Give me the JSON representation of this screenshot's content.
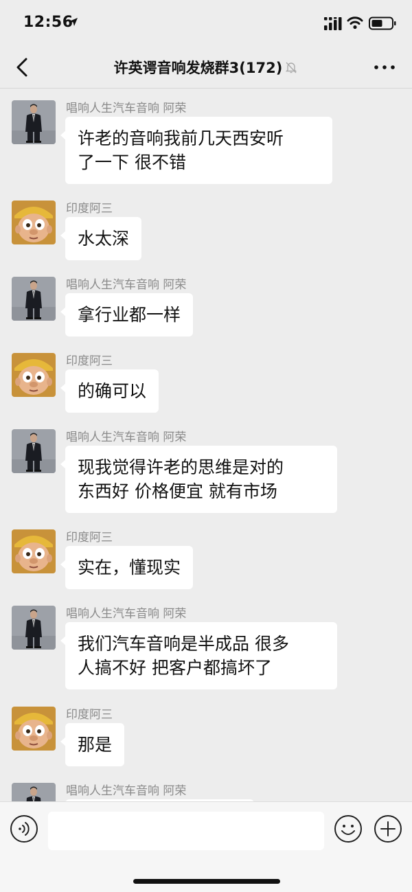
{
  "status_bar": {
    "time": "12:56"
  },
  "header": {
    "title": "许英谔音响发烧群3(172)"
  },
  "messages": [
    {
      "sender": "唱响人生汽车音响  阿荣",
      "avatar": "man-in-suit",
      "text": "许老的音响我前几天西安听\n了一下 很不错"
    },
    {
      "sender": "印度阿三",
      "avatar": "cartoon-boy",
      "text": "水太深"
    },
    {
      "sender": "唱响人生汽车音响  阿荣",
      "avatar": "man-in-suit",
      "text": "拿行业都一样"
    },
    {
      "sender": "印度阿三",
      "avatar": "cartoon-boy",
      "text": "的确可以"
    },
    {
      "sender": "唱响人生汽车音响  阿荣",
      "avatar": "man-in-suit",
      "text": "现我觉得许老的思维是对的\n东西好 价格便宜 就有市场"
    },
    {
      "sender": "印度阿三",
      "avatar": "cartoon-boy",
      "text": "实在，懂现实"
    },
    {
      "sender": "唱响人生汽车音响  阿荣",
      "avatar": "man-in-suit",
      "text": "我们汽车音响是半成品 很多\n人搞不好 把客户都搞坏了"
    },
    {
      "sender": "印度阿三",
      "avatar": "cartoon-boy",
      "text": "那是"
    },
    {
      "sender": "唱响人生汽车音响  阿荣",
      "avatar": "man-in-suit",
      "text": ""
    }
  ],
  "input_bar": {
    "placeholder": ""
  },
  "colors": {
    "background": "#ededed",
    "bubble": "#ffffff",
    "sender": "#8a8a8a"
  }
}
